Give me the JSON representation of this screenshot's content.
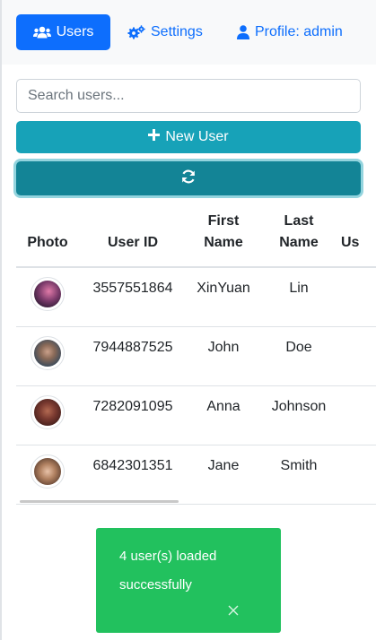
{
  "nav": {
    "users_label": "Users",
    "settings_label": "Settings",
    "profile_label": "Profile: admin"
  },
  "search": {
    "placeholder": "Search users..."
  },
  "actions": {
    "new_user_label": "New User"
  },
  "table": {
    "headers": {
      "photo": "Photo",
      "user_id": "User ID",
      "first_name_1": "First",
      "first_name_2": "Name",
      "last_name_1": "Last",
      "last_name_2": "Name",
      "extra": "Us"
    },
    "rows": [
      {
        "user_id": "3557551864",
        "first_name": "XinYuan",
        "last_name": "Lin"
      },
      {
        "user_id": "7944887525",
        "first_name": "John",
        "last_name": "Doe"
      },
      {
        "user_id": "7282091095",
        "first_name": "Anna",
        "last_name": "Johnson"
      },
      {
        "user_id": "6842301351",
        "first_name": "Jane",
        "last_name": "Smith"
      }
    ]
  },
  "toast": {
    "message": "4 user(s) loaded successfully"
  },
  "colors": {
    "primary": "#0d6efd",
    "info": "#17a2b8",
    "info_active": "#138496",
    "success": "#22c15e"
  }
}
